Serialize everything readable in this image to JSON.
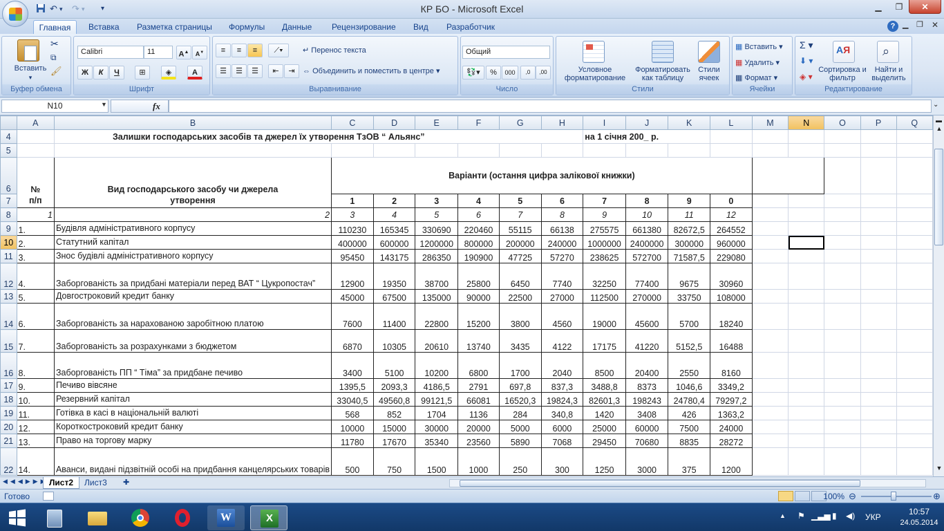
{
  "window": {
    "title": "КР БО - Microsoft Excel"
  },
  "tabs": [
    "Главная",
    "Вставка",
    "Разметка страницы",
    "Формулы",
    "Данные",
    "Рецензирование",
    "Вид",
    "Разработчик"
  ],
  "ribbon": {
    "clipboard": {
      "paste": "Вставить",
      "label": "Буфер обмена"
    },
    "font": {
      "name": "Calibri",
      "size": "11",
      "bold": "Ж",
      "italic": "К",
      "underline": "Ч",
      "label": "Шрифт"
    },
    "alignment": {
      "wrap": "Перенос текста",
      "merge": "Объединить и поместить в центре",
      "label": "Выравнивание"
    },
    "number": {
      "format": "Общий",
      "percent": "%",
      "thousands": "000",
      "label": "Число"
    },
    "styles": {
      "conditional": "Условное форматирование",
      "table": "Форматировать как таблицу",
      "cell": "Стили ячеек",
      "label": "Стили"
    },
    "cells": {
      "insert": "Вставить",
      "delete": "Удалить",
      "format": "Формат",
      "label": "Ячейки"
    },
    "editing": {
      "sort": "Сортировка и фильтр",
      "find": "Найти и выделить",
      "label": "Редактирование"
    }
  },
  "formula_bar": {
    "name_box": "N10",
    "fx": "fx",
    "value": ""
  },
  "columns": [
    "A",
    "B",
    "C",
    "D",
    "E",
    "F",
    "G",
    "H",
    "I",
    "J",
    "K",
    "L",
    "M",
    "N",
    "O",
    "P",
    "Q"
  ],
  "sheet": {
    "title_left": "Залишки господарських засобів та джерел їх утворення ТзОВ “ Альянс”",
    "title_right": "на 1 січня 200_ р.",
    "hdr_no": "№",
    "hdr_pp": "п/п",
    "hdr_kind": "Вид господарського засобу чи джерела",
    "hdr_kind2": "утворення",
    "hdr_variants": "Варіанти (остання цифра залікової книжки)",
    "variant_nums": [
      "1",
      "2",
      "3",
      "4",
      "5",
      "6",
      "7",
      "8",
      "9",
      "0"
    ],
    "col_nums": [
      "1",
      "2",
      "3",
      "4",
      "5",
      "6",
      "7",
      "8",
      "9",
      "10",
      "11",
      "12"
    ],
    "rows": [
      {
        "r": "9",
        "n": "1.",
        "name": "Будівля адміністративного корпусу",
        "v": [
          "110230",
          "165345",
          "330690",
          "220460",
          "55115",
          "66138",
          "275575",
          "661380",
          "82672,5",
          "264552"
        ]
      },
      {
        "r": "10",
        "n": "2.",
        "name": "Статутний капітал",
        "v": [
          "400000",
          "600000",
          "1200000",
          "800000",
          "200000",
          "240000",
          "1000000",
          "2400000",
          "300000",
          "960000"
        ]
      },
      {
        "r": "11",
        "n": "3.",
        "name": "Знос будівлі адміністративного корпусу",
        "v": [
          "95450",
          "143175",
          "286350",
          "190900",
          "47725",
          "57270",
          "238625",
          "572700",
          "71587,5",
          "229080"
        ]
      },
      {
        "r": "12",
        "n": "4.",
        "name": "Заборгованість за придбані матеріали перед ВАТ “ Цукропостач”",
        "v": [
          "12900",
          "19350",
          "38700",
          "25800",
          "6450",
          "7740",
          "32250",
          "77400",
          "9675",
          "30960"
        ]
      },
      {
        "r": "13",
        "n": "5.",
        "name": "Довгостроковий кредит банку",
        "v": [
          "45000",
          "67500",
          "135000",
          "90000",
          "22500",
          "27000",
          "112500",
          "270000",
          "33750",
          "108000"
        ]
      },
      {
        "r": "14",
        "n": "6.",
        "name": "Заборгованість за нарахованою заробітною платою",
        "v": [
          "7600",
          "11400",
          "22800",
          "15200",
          "3800",
          "4560",
          "19000",
          "45600",
          "5700",
          "18240"
        ]
      },
      {
        "r": "15",
        "n": "7.",
        "name": "Заборгованість за розрахунками з бюджетом",
        "v": [
          "6870",
          "10305",
          "20610",
          "13740",
          "3435",
          "4122",
          "17175",
          "41220",
          "5152,5",
          "16488"
        ]
      },
      {
        "r": "16",
        "n": "8.",
        "name": "Заборгованість ПП “ Тіма” за придбане печиво",
        "v": [
          "3400",
          "5100",
          "10200",
          "6800",
          "1700",
          "2040",
          "8500",
          "20400",
          "2550",
          "8160"
        ]
      },
      {
        "r": "17",
        "n": "9.",
        "name": "Печиво вівсяне",
        "v": [
          "1395,5",
          "2093,3",
          "4186,5",
          "2791",
          "697,8",
          "837,3",
          "3488,8",
          "8373",
          "1046,6",
          "3349,2"
        ]
      },
      {
        "r": "18",
        "n": "10.",
        "name": "Резервний капітал",
        "v": [
          "33040,5",
          "49560,8",
          "99121,5",
          "66081",
          "16520,3",
          "19824,3",
          "82601,3",
          "198243",
          "24780,4",
          "79297,2"
        ]
      },
      {
        "r": "19",
        "n": "11.",
        "name": "Готівка в касі в національній валюті",
        "v": [
          "568",
          "852",
          "1704",
          "1136",
          "284",
          "340,8",
          "1420",
          "3408",
          "426",
          "1363,2"
        ]
      },
      {
        "r": "20",
        "n": "12.",
        "name": "Короткостроковий кредит банку",
        "v": [
          "10000",
          "15000",
          "30000",
          "20000",
          "5000",
          "6000",
          "25000",
          "60000",
          "7500",
          "24000"
        ]
      },
      {
        "r": "21",
        "n": "13.",
        "name": "Право на торгову марку",
        "v": [
          "11780",
          "17670",
          "35340",
          "23560",
          "5890",
          "7068",
          "29450",
          "70680",
          "8835",
          "28272"
        ]
      },
      {
        "r": "22",
        "n": "14.",
        "name": "Аванси,  видані підзвітній особі на придбання канцелярських товарів",
        "v": [
          "500",
          "750",
          "1500",
          "1000",
          "250",
          "300",
          "1250",
          "3000",
          "375",
          "1200"
        ]
      }
    ]
  },
  "sheet_tabs": [
    "Лист2",
    "Лист3"
  ],
  "status": {
    "ready": "Готово",
    "zoom": "100%"
  },
  "taskbar": {
    "lang": "УКР",
    "time": "10:57",
    "date": "24.05.2014"
  }
}
